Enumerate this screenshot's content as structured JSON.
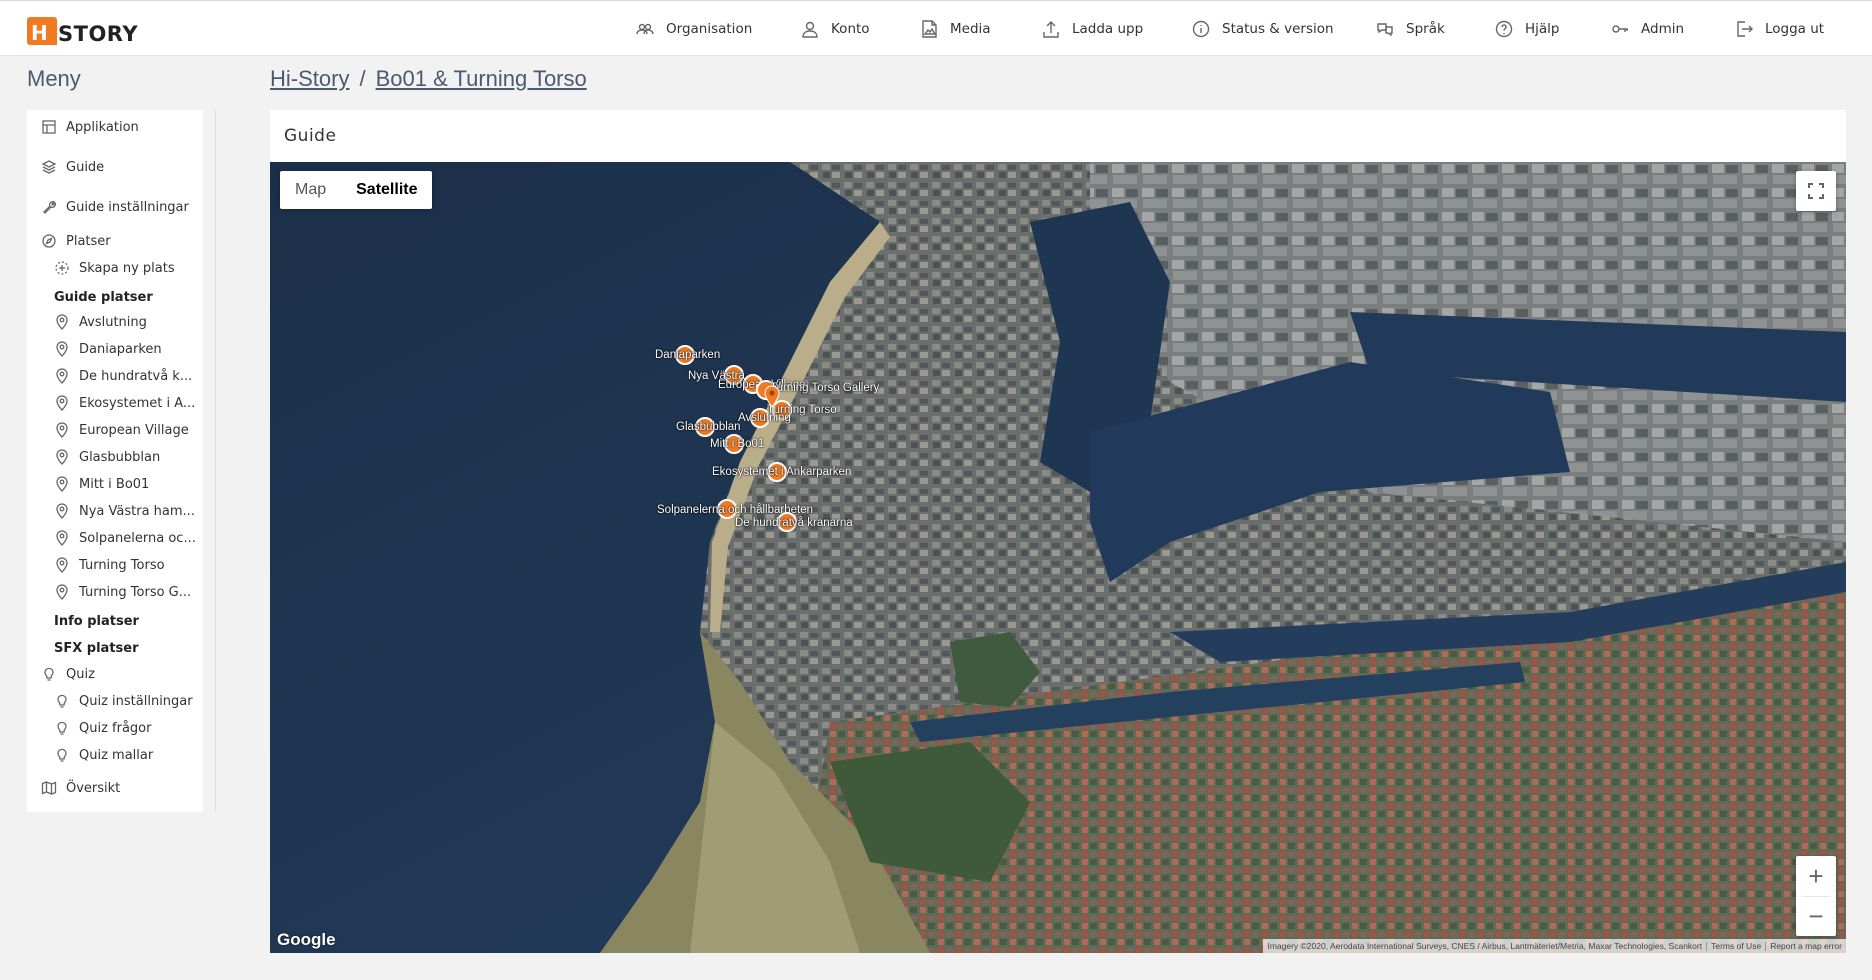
{
  "header": {
    "logo_text": "STORY",
    "nav": [
      {
        "label": "Organisation",
        "icon": "people-icon"
      },
      {
        "label": "Konto",
        "icon": "user-icon"
      },
      {
        "label": "Media",
        "icon": "image-icon"
      },
      {
        "label": "Ladda upp",
        "icon": "upload-icon"
      },
      {
        "label": "Status & version",
        "icon": "info-icon"
      },
      {
        "label": "Språk",
        "icon": "language-icon"
      },
      {
        "label": "Hjälp",
        "icon": "help-icon"
      },
      {
        "label": "Admin",
        "icon": "key-icon"
      },
      {
        "label": "Logga ut",
        "icon": "logout-icon"
      }
    ]
  },
  "sidebar": {
    "title": "Meny",
    "items": {
      "applikation": "Applikation",
      "guide": "Guide",
      "guide_settings": "Guide inställningar",
      "platser": "Platser",
      "create_place": "Skapa ny plats",
      "guide_places_head": "Guide platser",
      "guide_places": [
        "Avslutning",
        "Daniaparken",
        "De hundratvå k...",
        "Ekosystemet i A...",
        "European Village",
        "Glasbubblan",
        "Mitt i Bo01",
        "Nya Västra ham...",
        "Solpanelerna oc...",
        "Turning Torso",
        "Turning Torso G..."
      ],
      "info_places": "Info platser",
      "sfx_places": "SFX platser",
      "quiz": "Quiz",
      "quiz_settings": "Quiz inställningar",
      "quiz_questions": "Quiz frågor",
      "quiz_templates": "Quiz mallar",
      "overview": "Översikt"
    }
  },
  "breadcrumb": {
    "root": "Hi-Story",
    "separator": "/",
    "current": "Bo01 & Turning Torso"
  },
  "card": {
    "title": "Guide"
  },
  "map": {
    "type_buttons": {
      "map": "Map",
      "satellite": "Satellite",
      "selected": "Satellite"
    },
    "zoom_in": "+",
    "zoom_out": "−",
    "google": "Google",
    "attribution": "Imagery ©2020, Aerodata International Surveys, CNES / Airbus, Lantmäteriet/Metria, Maxar Technologies, Scankort",
    "terms": "Terms of Use",
    "report": "Report a map error",
    "marker_labels": [
      "Daniaparken",
      "Nya Västra",
      "European Village",
      "Turning Torso",
      "Turning Torso Gallery",
      "Avslutning",
      "Glasbubblan",
      "Mitt i Bo01",
      "Ekosystemet i Ankarparken",
      "Solpanelerna och hållbarheten",
      "De hundratvå kranarna"
    ]
  },
  "colors": {
    "accent": "#ef7a22",
    "text_link": "#4a5a70"
  }
}
